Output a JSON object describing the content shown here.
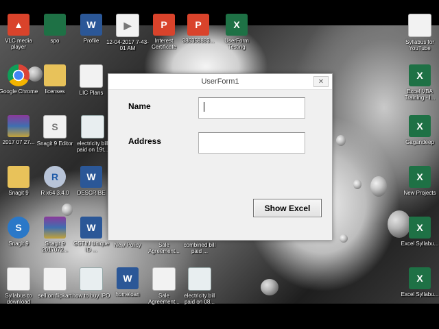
{
  "dialog": {
    "title": "UserForm1",
    "close_glyph": "✕",
    "name_label": "Name",
    "address_label": "Address",
    "name_value": "",
    "address_value": "",
    "button_label": "Show Excel"
  },
  "desktop_icons": [
    {
      "label": "VLC media player",
      "icon": "vlc-icon"
    },
    {
      "label": "spo",
      "icon": "spo-icon"
    },
    {
      "label": "Profile",
      "icon": "word-icon"
    },
    {
      "label": "12-04-2017 7-43-01 AM",
      "icon": "video-icon"
    },
    {
      "label": "Interest Certificate",
      "icon": "pdf-icon"
    },
    {
      "label": "386358883...",
      "icon": "pdf-icon"
    },
    {
      "label": "UserForm Testing",
      "icon": "excel-icon"
    },
    {
      "label": "Syllabus for YouTube",
      "icon": "document-icon"
    },
    {
      "label": "Google Chrome",
      "icon": "chrome-icon"
    },
    {
      "label": "licenses",
      "icon": "folder-icon"
    },
    {
      "label": "LIC Plans",
      "icon": "document-icon"
    },
    {
      "label": "Excel VBA Training - I...",
      "icon": "excel-icon"
    },
    {
      "label": "2017 07 27...",
      "icon": "winrar-icon"
    },
    {
      "label": "Snagit 9 Editor",
      "icon": "snagit-editor-icon"
    },
    {
      "label": "electricity bill paid on 19t...",
      "icon": "screenshot-icon"
    },
    {
      "label": "Gagandeep",
      "icon": "excel-icon"
    },
    {
      "label": "Snagit 9",
      "icon": "folder-icon"
    },
    {
      "label": "R x64 3.4.0",
      "icon": "r-icon"
    },
    {
      "label": "DESCRIBE",
      "icon": "word-icon"
    },
    {
      "label": "New Projects",
      "icon": "excel-icon"
    },
    {
      "label": "Snagit 9",
      "icon": "snagit-icon"
    },
    {
      "label": "Snagit 9 2017072...",
      "icon": "winrar-icon"
    },
    {
      "label": "GSTIN Unique ID ...",
      "icon": "word-icon"
    },
    {
      "label": "New Policy",
      "icon": "document-icon"
    },
    {
      "label": "Sale Agreement...",
      "icon": "document-icon"
    },
    {
      "label": "combined bill paid ...",
      "icon": "document-icon"
    },
    {
      "label": "Excel Syllabu...",
      "icon": "excel-icon"
    },
    {
      "label": "Syllabus to download",
      "icon": "document-icon"
    },
    {
      "label": "sell on flipkart",
      "icon": "document-icon"
    },
    {
      "label": "how to buy IPO",
      "icon": "screenshot-icon"
    },
    {
      "label": "homeloan",
      "icon": "word-icon"
    },
    {
      "label": "Sale Agreement...",
      "icon": "image-icon"
    },
    {
      "label": "electricity bill paid on 08...",
      "icon": "screenshot-icon"
    },
    {
      "label": "Excel Syllabu...",
      "icon": "excel-icon"
    }
  ]
}
